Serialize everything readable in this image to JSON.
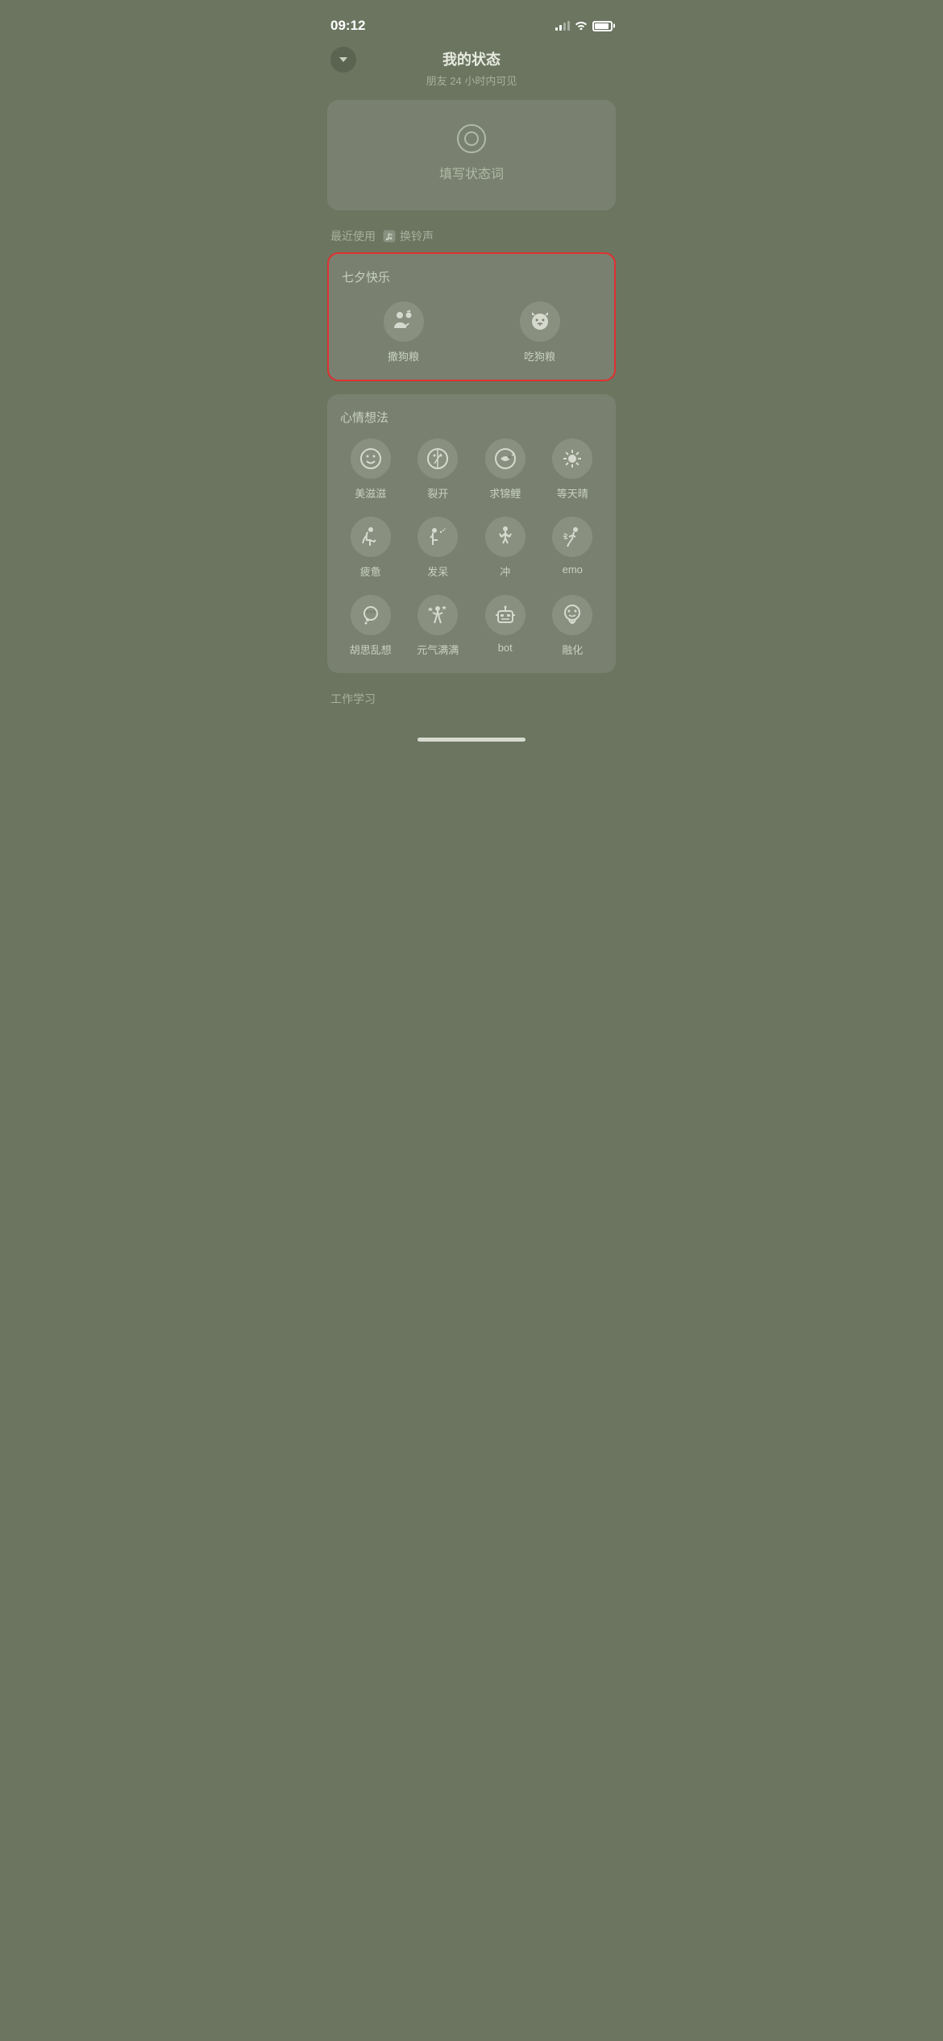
{
  "statusBar": {
    "time": "09:12"
  },
  "header": {
    "title": "我的状态",
    "subtitle": "朋友 24 小时内可见",
    "backLabel": "back"
  },
  "inputCard": {
    "placeholder": "填写状态词"
  },
  "recentSection": {
    "label": "最近使用",
    "musicIcon": "♫",
    "changeRingtone": "换铃声"
  },
  "qixiSection": {
    "title": "七夕快乐",
    "items": [
      {
        "icon": "couple",
        "label": "撒狗粮"
      },
      {
        "icon": "cat",
        "label": "吃狗粮"
      }
    ]
  },
  "moodSection": {
    "title": "心情想法",
    "items": [
      {
        "icon": "smile",
        "label": "美滋滋"
      },
      {
        "icon": "crack",
        "label": "裂开"
      },
      {
        "icon": "koi",
        "label": "求锦鲤"
      },
      {
        "icon": "sun",
        "label": "等天晴"
      },
      {
        "icon": "tired",
        "label": "疲惫"
      },
      {
        "icon": "daze",
        "label": "发呆"
      },
      {
        "icon": "rush",
        "label": "冲"
      },
      {
        "icon": "emo",
        "label": "emo"
      },
      {
        "icon": "daydream",
        "label": "胡思乱想"
      },
      {
        "icon": "energetic",
        "label": "元气满满"
      },
      {
        "icon": "bot",
        "label": "bot"
      },
      {
        "icon": "melt",
        "label": "融化"
      }
    ]
  },
  "workSection": {
    "title": "工作学习"
  },
  "colors": {
    "bg": "#6b7560",
    "card": "#7a8070",
    "text": "#c8d0be",
    "subtext": "#a8b09e",
    "highlight": "#e03030"
  }
}
